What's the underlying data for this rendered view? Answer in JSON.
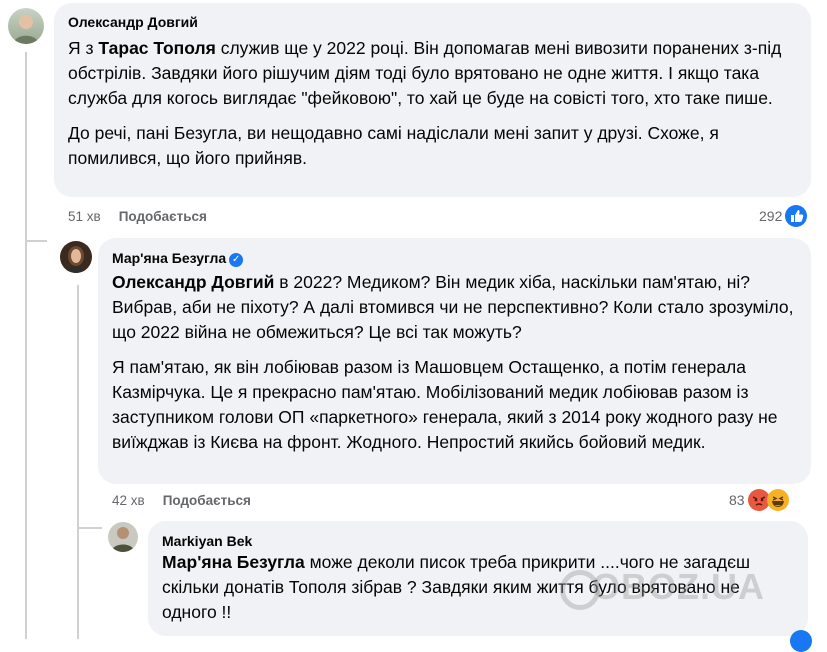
{
  "comments": [
    {
      "author": "Олександр Довгий",
      "mention": "Тарас Тополя",
      "p1_before": "Я з ",
      "p1_after": " служив ще у 2022 році. Він допомагав мені вивозити поранених з-під обстрілів. Завдяки його рішучим діям тоді було врятовано не одне життя. І якщо така служба для когось виглядає \"фейковою\", то хай це буде на совісті того, хто таке пише.",
      "p2": "До речі, пані Безугла, ви нещодавно самі надіслали мені запит у друзі. Схоже, я помилився, що його прийняв.",
      "time": "51 хв",
      "like_label": "Подобається",
      "reaction_count": "292",
      "reaction_icons": [
        "like-icon"
      ]
    },
    {
      "author": "Мар'яна Безугла",
      "verified": true,
      "mention": "Олександр Довгий",
      "p1_after": " в 2022? Медиком? Він медик хіба, наскільки пам'ятаю, ні? Вибрав, аби не піхоту? А далі втомився чи не перспективно? Коли стало зрозуміло, що 2022 війна не обмежиться? Це всі так можуть?",
      "p2": "Я пам'ятаю, як він лобіював разом із Машовцем Остащенко, а потім генерала Казмірчука. Це я прекрасно пам'ятаю. Мобілізований медик лобіював разом із заступником голови ОП «паркетного» генерала, який з 2014 року жодного разу не виїжджав із Києва на фронт. Жодного. Непростий якийсь бойовий медик.",
      "time": "42 хв",
      "like_label": "Подобається",
      "reaction_count": "83",
      "reaction_icons": [
        "angry-icon",
        "haha-icon"
      ]
    },
    {
      "author": "Markiyan Bek",
      "mention": "Мар'яна Безугла",
      "p1_after": " може деколи писок треба прикрити ....чого не загадєш скільки донатів Тополя зібрав ? Завдяки яким життя було врятовано не одного !!"
    }
  ],
  "watermark": "OBOZ.UA",
  "colors": {
    "bubble": "#f0f2f5",
    "meta": "#65676b",
    "like_blue": "#1877f2",
    "angry": "#e8573f",
    "haha": "#f7b125"
  }
}
